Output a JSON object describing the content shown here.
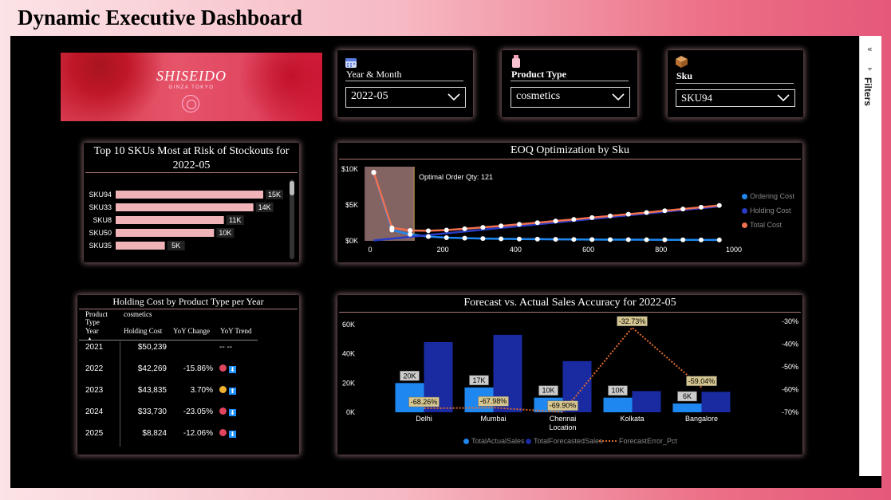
{
  "title": "Dynamic Executive Dashboard",
  "filters_pane": {
    "label": "Filters"
  },
  "banner": {
    "brand": "SHISEIDO",
    "sub": "GINZA TOKYO"
  },
  "slicers": {
    "year_month": {
      "title": "Year & Month",
      "value": "2022-05",
      "icon": "calendar-icon"
    },
    "product_type": {
      "title": "Product Type",
      "value": "cosmetics",
      "icon": "bottle-icon"
    },
    "sku": {
      "title": "Sku",
      "value": "SKU94",
      "icon": "box-icon"
    }
  },
  "top_skus": {
    "title": "Top 10 SKUs Most at Risk of Stockouts for 2022-05",
    "chart_data": {
      "type": "bar",
      "categories": [
        "SKU94",
        "SKU33",
        "SKU8",
        "SKU50",
        "SKU35"
      ],
      "values": [
        15,
        14,
        11,
        10,
        5
      ],
      "labels": [
        "15K",
        "14K",
        "11K",
        "10K",
        "5K"
      ]
    }
  },
  "eoq": {
    "title": "EOQ Optimization by Sku",
    "annotation": "Optimal Order Qty: 121",
    "chart_data": {
      "type": "line",
      "x": [
        10,
        60,
        110,
        160,
        210,
        260,
        310,
        360,
        410,
        460,
        510,
        560,
        610,
        660,
        710,
        760,
        810,
        860,
        910,
        960
      ],
      "xlim": [
        0,
        1000
      ],
      "xticks": [
        "0",
        "200",
        "400",
        "600",
        "800",
        "1000"
      ],
      "yticks": [
        "$0K",
        "$5K",
        "$10K"
      ],
      "ylim": [
        0,
        10000
      ],
      "series": [
        {
          "name": "Ordering Cost",
          "color": "#1e88f0",
          "values": [
            9500,
            1500,
            900,
            600,
            450,
            380,
            320,
            280,
            250,
            230,
            210,
            190,
            180,
            170,
            160,
            150,
            140,
            135,
            130,
            125
          ]
        },
        {
          "name": "Holding Cost",
          "color": "#2a3cc4",
          "values": [
            50,
            300,
            550,
            800,
            1050,
            1300,
            1550,
            1800,
            2050,
            2300,
            2550,
            2800,
            3050,
            3300,
            3550,
            3800,
            4050,
            4300,
            4550,
            4800
          ]
        },
        {
          "name": "Total Cost",
          "color": "#f07050",
          "values": [
            9550,
            1800,
            1450,
            1400,
            1500,
            1680,
            1870,
            2080,
            2300,
            2530,
            2760,
            2990,
            3230,
            3470,
            3710,
            3950,
            4190,
            4435,
            4680,
            4925
          ]
        }
      ]
    }
  },
  "holding": {
    "title": "Holding Cost by Product Type per Year",
    "header_product": "Product Type",
    "header_year": "Year",
    "header_cosmetics": "cosmetics",
    "col_holding": "Holding Cost",
    "col_yoy": "YoY Change",
    "col_trend": "YoY Trend",
    "rows": [
      {
        "year": "2021",
        "cost": "$50,239",
        "yoy": "",
        "trend": "-- --",
        "dot": "",
        "arrow": ""
      },
      {
        "year": "2022",
        "cost": "$42,269",
        "yoy": "-15.86%",
        "trend": "",
        "dot": "#e0445f",
        "arrow": "⬇"
      },
      {
        "year": "2023",
        "cost": "$43,835",
        "yoy": "3.70%",
        "trend": "",
        "dot": "#f0b030",
        "arrow": "⬆"
      },
      {
        "year": "2024",
        "cost": "$33,730",
        "yoy": "-23.05%",
        "trend": "",
        "dot": "#e0445f",
        "arrow": "⬇"
      },
      {
        "year": "2025",
        "cost": "$8,824",
        "yoy": "-12.06%",
        "trend": "",
        "dot": "#e0445f",
        "arrow": "⬇"
      }
    ]
  },
  "forecast": {
    "title": "Forecast vs. Actual Sales Accuracy for 2022-05",
    "chart_data": {
      "type": "bar",
      "categories": [
        "Delhi",
        "Mumbai",
        "Chennai",
        "Kolkata",
        "Bangalore"
      ],
      "category_labels": [
        [
          "Delhi"
        ],
        [
          "Mumbai"
        ],
        [
          "Chennai",
          "Location"
        ],
        [
          "Kolkata"
        ],
        [
          "Bangalore"
        ]
      ],
      "ylim": [
        0,
        60000
      ],
      "yticks": [
        "0K",
        "20K",
        "40K",
        "60K"
      ],
      "y2lim": [
        -70,
        -30
      ],
      "y2ticks": [
        "-30%",
        "-40%",
        "-50%",
        "-60%",
        "-70%"
      ],
      "series": [
        {
          "name": "TotalActualSales",
          "color": "#1e88f0",
          "values": [
            20000,
            17000,
            10000,
            10000,
            6000
          ],
          "labels": [
            "20K",
            "17K",
            "10K",
            "10K",
            "6K"
          ]
        },
        {
          "name": "TotalForecastedSales",
          "color": "#1a2aa0",
          "values": [
            48000,
            53000,
            35000,
            14500,
            14000
          ]
        },
        {
          "name": "ForecastError_Pct",
          "color": "#e06a30",
          "values": [
            -68.26,
            -67.98,
            -69.9,
            -32.73,
            -59.04
          ],
          "labels": [
            "-68.26%",
            "-67.98%",
            "-69.90%",
            "-32.73%",
            "-59.04%"
          ]
        }
      ]
    }
  }
}
